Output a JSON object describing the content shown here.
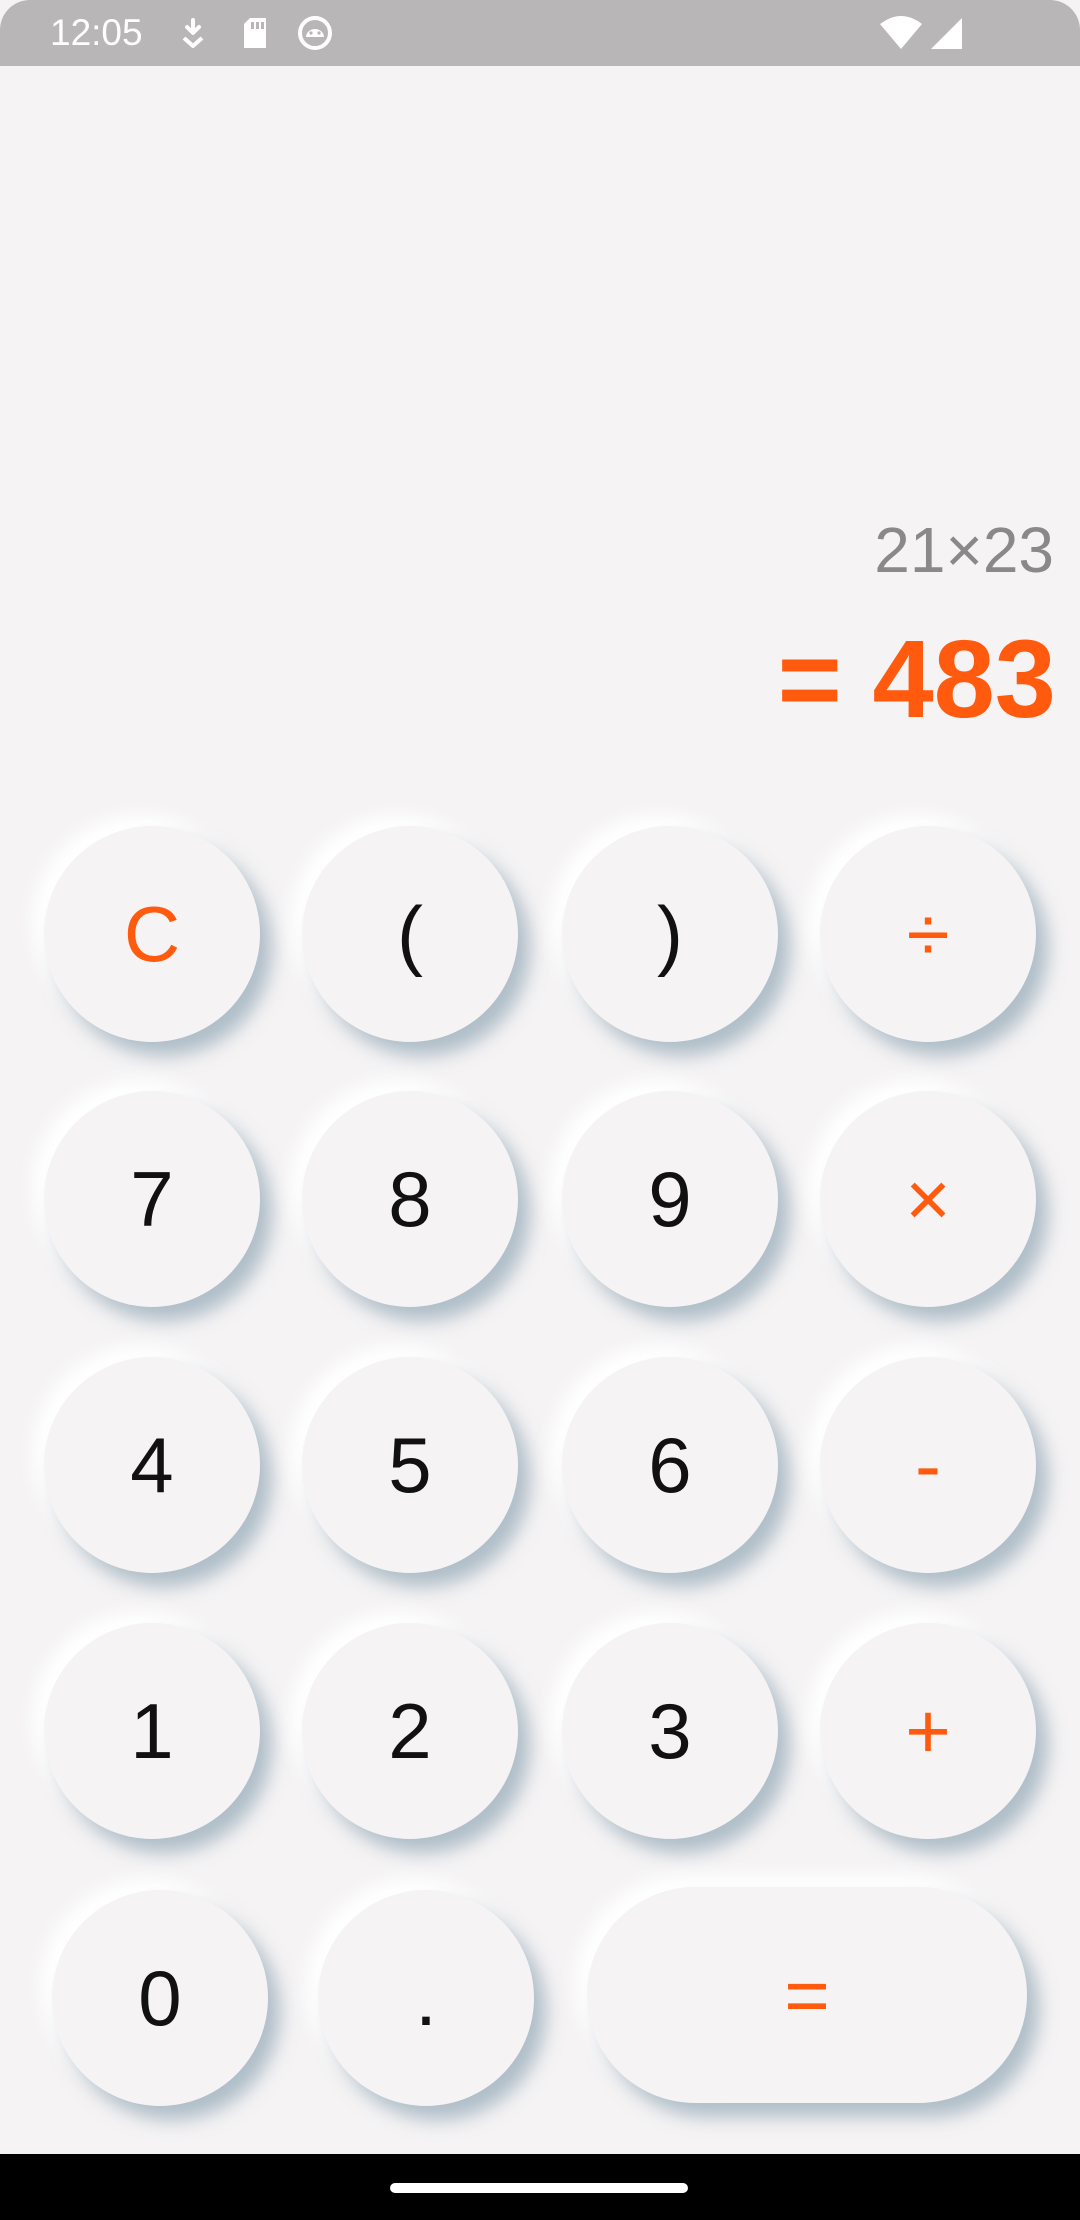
{
  "status_bar": {
    "time": "12:05",
    "icons": [
      "download-icon",
      "sd-card-icon",
      "android-debug-icon",
      "wifi-icon",
      "cell-signal-icon"
    ]
  },
  "display": {
    "expression": "21×23",
    "result": "= 483"
  },
  "keypad": {
    "rows": [
      [
        "C",
        "(",
        ")",
        "÷"
      ],
      [
        "7",
        "8",
        "9",
        "×"
      ],
      [
        "4",
        "5",
        "6",
        "-"
      ],
      [
        "1",
        "2",
        "3",
        "+"
      ],
      [
        "0",
        ".",
        "="
      ]
    ]
  },
  "colors": {
    "background": "#f5f3f4",
    "accent": "#ff5a0e",
    "digit": "#111111",
    "expression": "#8a8889"
  }
}
